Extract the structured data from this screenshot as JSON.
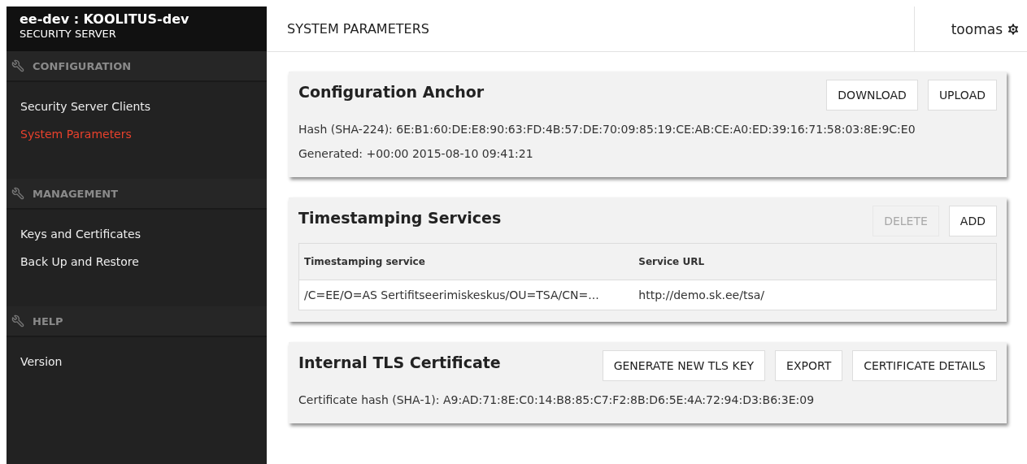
{
  "header": {
    "title": "ee-dev : KOOLITUS-dev",
    "subtitle": "SECURITY SERVER"
  },
  "sidebar": {
    "sections": [
      {
        "title": "CONFIGURATION",
        "items": [
          {
            "label": "Security Server Clients",
            "selected": false
          },
          {
            "label": "System Parameters",
            "selected": true
          }
        ]
      },
      {
        "title": "MANAGEMENT",
        "items": [
          {
            "label": "Keys and Certificates",
            "selected": false
          },
          {
            "label": "Back Up and Restore",
            "selected": false
          }
        ]
      },
      {
        "title": "HELP",
        "items": [
          {
            "label": "Version",
            "selected": false
          }
        ]
      }
    ]
  },
  "page_title": "SYSTEM PARAMETERS",
  "user": "toomas",
  "cards": [
    {
      "kind": "info",
      "title": "Configuration Anchor",
      "buttons": [
        {
          "label": "DOWNLOAD",
          "disabled": false
        },
        {
          "label": "UPLOAD",
          "disabled": false
        }
      ],
      "lines": [
        "Hash (SHA-224): 6E:B1:60:DE:E8:90:63:FD:4B:57:DE:70:09:85:19:CE:AB:CE:A0:ED:39:16:71:58:03:8E:9C:E0",
        "Generated: +00:00 2015-08-10 09:41:21"
      ]
    },
    {
      "kind": "table",
      "title": "Timestamping Services",
      "buttons": [
        {
          "label": "DELETE",
          "disabled": true
        },
        {
          "label": "ADD",
          "disabled": false
        }
      ],
      "table": {
        "columns": [
          "Timestamping service",
          "Service URL"
        ],
        "rows": [
          [
            "/C=EE/O=AS Sertifitseerimiskeskus/OU=TSA/CN=...",
            "http://demo.sk.ee/tsa/"
          ]
        ]
      }
    },
    {
      "kind": "info",
      "title": "Internal TLS Certificate",
      "buttons": [
        {
          "label": "GENERATE NEW TLS KEY",
          "disabled": false
        },
        {
          "label": "EXPORT",
          "disabled": false
        },
        {
          "label": "CERTIFICATE DETAILS",
          "disabled": false
        }
      ],
      "lines": [
        "Certificate hash (SHA-1): A9:AD:71:8E:C0:14:B8:85:C7:F2:8B:D6:5E:4A:72:94:D3:B6:3E:09"
      ]
    }
  ]
}
